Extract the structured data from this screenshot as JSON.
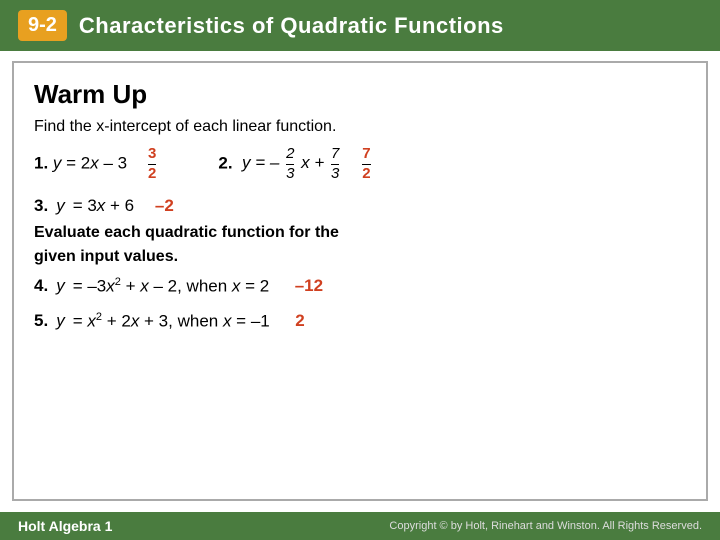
{
  "header": {
    "badge": "9-2",
    "title": "Characteristics of Quadratic Functions"
  },
  "warmup": {
    "title": "Warm Up",
    "subtitle": "Find the x-intercept of each linear function.",
    "problem1": {
      "label": "1.",
      "equation": "y = 2x – 3",
      "answer": "3/2"
    },
    "problem2": {
      "label": "2.",
      "answer": "7/2"
    },
    "problem3": {
      "label": "3.",
      "equation": "y = 3x + 6",
      "answer": "–2"
    },
    "evaluate_text1": "Evaluate each quadratic function for the",
    "evaluate_text2": "given input values.",
    "problem4": {
      "label": "4.",
      "equation": "y = –3x² + x – 2, when x = 2",
      "answer": "–12"
    },
    "problem5": {
      "label": "5.",
      "equation": "y = x² + 2x + 3, when x = –1",
      "answer": "2"
    }
  },
  "footer": {
    "left": "Holt Algebra 1",
    "right": "Copyright © by Holt, Rinehart and Winston. All Rights Reserved."
  }
}
